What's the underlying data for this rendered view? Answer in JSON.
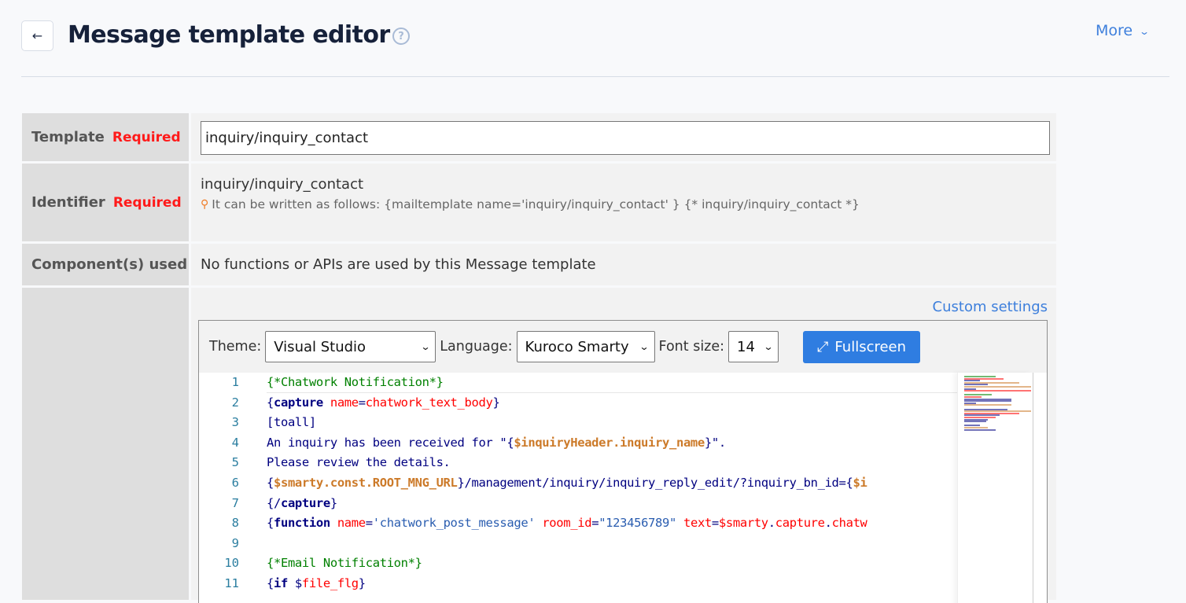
{
  "header": {
    "title": "Message template editor",
    "back_icon": "arrow-left-icon",
    "help_icon": "question-circle-icon",
    "more_label": "More",
    "more_icon": "chevron-down-icon"
  },
  "form": {
    "template": {
      "label": "Template",
      "required": "Required",
      "value": "inquiry/inquiry_contact"
    },
    "identifier": {
      "label": "Identifier",
      "required": "Required",
      "value": "inquiry/inquiry_contact",
      "hint_icon": "lightbulb-icon",
      "hint": "It can be written as follows: {mailtemplate name='inquiry/inquiry_contact' } {* inquiry/inquiry_contact *}"
    },
    "components": {
      "label": "Component(s) used",
      "value": "No functions or APIs are used by this Message template"
    }
  },
  "editor": {
    "custom_settings_label": "Custom settings",
    "theme_label": "Theme:",
    "theme_value": "Visual Studio",
    "language_label": "Language:",
    "language_value": "Kuroco Smarty",
    "font_size_label": "Font size:",
    "font_size_value": "14",
    "fullscreen_label": "Fullscreen",
    "fullscreen_icon": "expand-arrows-icon",
    "colors": {
      "comment": "#008000",
      "keyword": "#000080",
      "attribute": "#ff0000",
      "variable": "#cc7a29",
      "string": "#2a5db0",
      "line_number": "#2b7ea0"
    },
    "lines": [
      {
        "n": "1",
        "tokens": [
          [
            "t-cmt",
            "{*Chatwork Notification*}"
          ]
        ]
      },
      {
        "n": "2",
        "tokens": [
          [
            "t-plain",
            "{"
          ],
          [
            "t-kw",
            "capture"
          ],
          [
            "t-plain",
            " "
          ],
          [
            "t-attr",
            "name"
          ],
          [
            "t-plain",
            "="
          ],
          [
            "t-attr",
            "chatwork_text_body"
          ],
          [
            "t-plain",
            "}"
          ]
        ]
      },
      {
        "n": "3",
        "tokens": [
          [
            "t-plain",
            "[toall]"
          ]
        ]
      },
      {
        "n": "4",
        "tokens": [
          [
            "t-plain",
            "An inquiry has been received for \"{"
          ],
          [
            "t-var",
            "$inquiryHeader.inquiry_name"
          ],
          [
            "t-plain",
            "}\"."
          ]
        ]
      },
      {
        "n": "5",
        "tokens": [
          [
            "t-plain",
            "Please review the details."
          ]
        ]
      },
      {
        "n": "6",
        "tokens": [
          [
            "t-plain",
            "{"
          ],
          [
            "t-var",
            "$smarty.const.ROOT_MNG_URL"
          ],
          [
            "t-plain",
            "}/management/inquiry/inquiry_reply_edit/?inquiry_bn_id={"
          ],
          [
            "t-var",
            "$i"
          ]
        ]
      },
      {
        "n": "7",
        "tokens": [
          [
            "t-plain",
            "{/"
          ],
          [
            "t-kw",
            "capture"
          ],
          [
            "t-plain",
            "}"
          ]
        ]
      },
      {
        "n": "8",
        "tokens": [
          [
            "t-plain",
            "{"
          ],
          [
            "t-kw",
            "function"
          ],
          [
            "t-plain",
            " "
          ],
          [
            "t-attr",
            "name"
          ],
          [
            "t-plain",
            "="
          ],
          [
            "t-str",
            "'chatwork_post_message'"
          ],
          [
            "t-plain",
            " "
          ],
          [
            "t-attr",
            "room_id"
          ],
          [
            "t-plain",
            "="
          ],
          [
            "t-str",
            "\"123456789\""
          ],
          [
            "t-plain",
            " "
          ],
          [
            "t-attr",
            "text"
          ],
          [
            "t-plain",
            "="
          ],
          [
            "t-attr",
            "$smarty"
          ],
          [
            "t-plain",
            "."
          ],
          [
            "t-attr",
            "capture"
          ],
          [
            "t-plain",
            "."
          ],
          [
            "t-attr",
            "chatw"
          ]
        ]
      },
      {
        "n": "9",
        "tokens": [
          [
            "t-plain",
            ""
          ]
        ]
      },
      {
        "n": "10",
        "tokens": [
          [
            "t-cmt",
            "{*Email Notification*}"
          ]
        ]
      },
      {
        "n": "11",
        "tokens": [
          [
            "t-plain",
            "{"
          ],
          [
            "t-kw",
            "if"
          ],
          [
            "t-plain",
            " $"
          ],
          [
            "t-attr",
            "file_flg"
          ],
          [
            "t-plain",
            "}"
          ]
        ]
      }
    ]
  }
}
